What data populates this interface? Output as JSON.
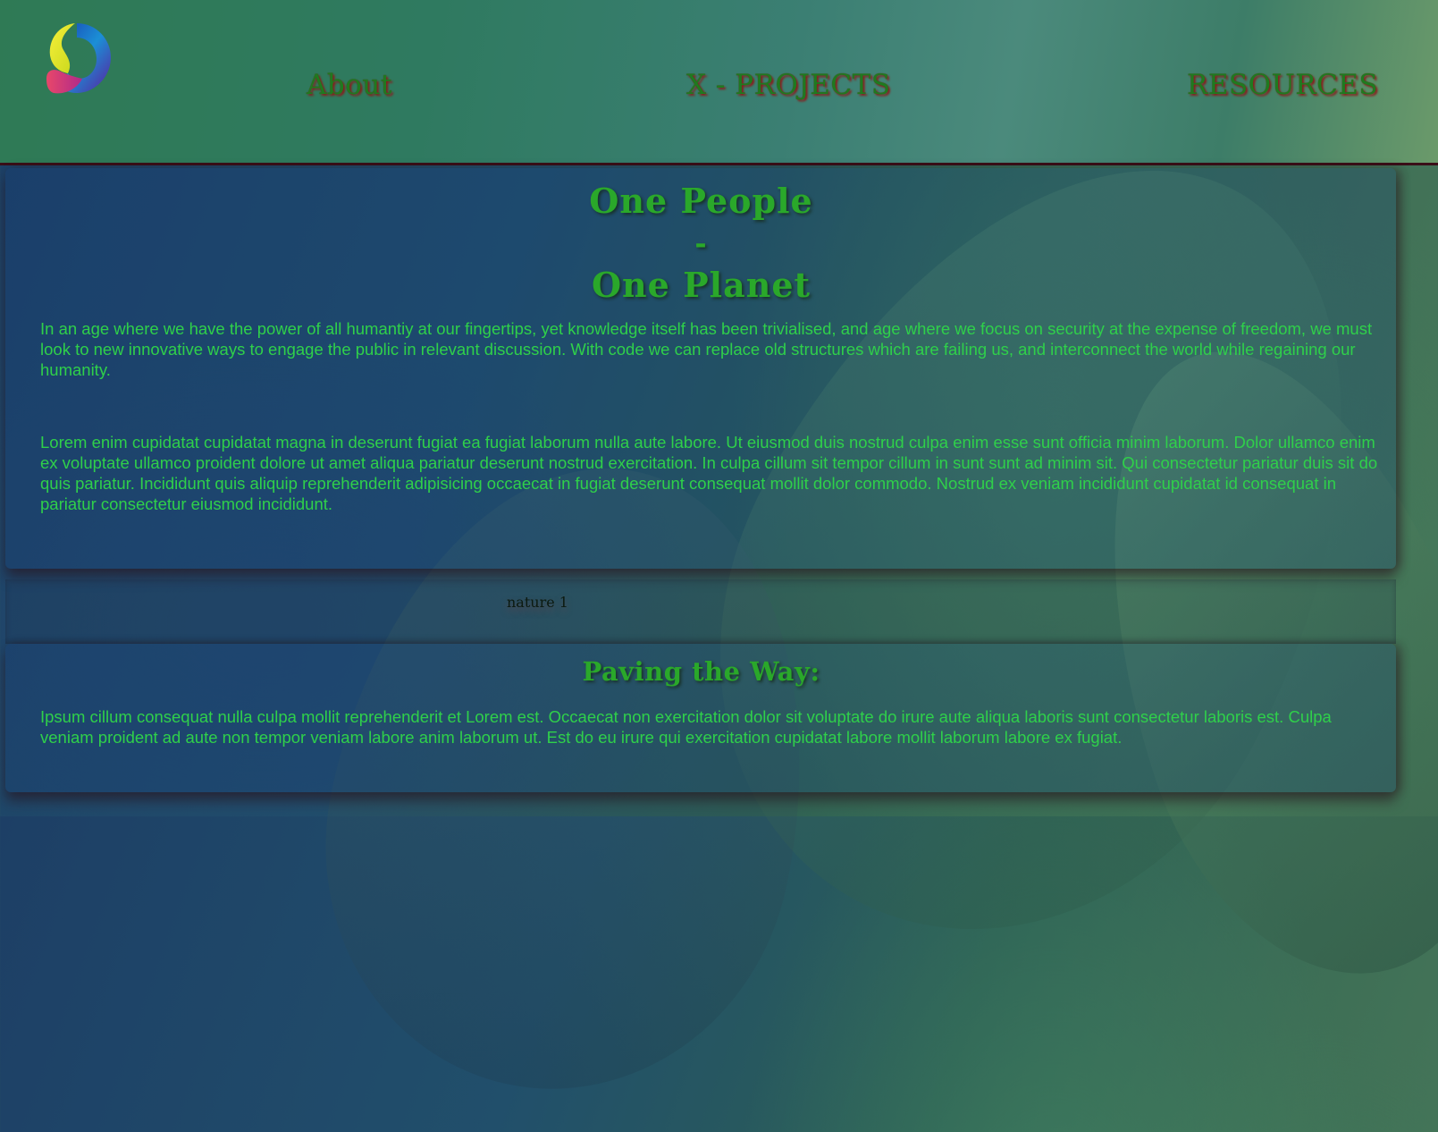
{
  "nav": {
    "items": [
      {
        "label": "About"
      },
      {
        "label": "X - PROJECTS"
      },
      {
        "label": "RESOURCES"
      }
    ]
  },
  "hero": {
    "line1": "One People",
    "line2": "-",
    "line3": "One Planet",
    "intro": "In an age where we have the power of all humantiy at our fingertips, yet knowledge itself has been trivialised, and age where we focus on security at the expense of freedom, we must look to new innovative ways to engage the public in relevant discussion. With code we can replace old structures which are failing us, and interconnect the world while regaining our humanity.",
    "lorem": "Lorem enim cupidatat cupidatat magna in deserunt fugiat ea fugiat laborum nulla aute labore. Ut eiusmod duis nostrud culpa enim esse sunt officia minim laborum. Dolor ullamco enim ex voluptate ullamco proident dolore ut amet aliqua pariatur deserunt nostrud exercitation. In culpa cillum sit tempor cillum in sunt sunt ad minim sit. Qui consectetur pariatur duis sit do quis pariatur. Incididunt quis aliquip reprehenderit adipisicing occaecat in fugiat deserunt consequat mollit dolor commodo. Nostrud ex veniam incididunt cupidatat id consequat in pariatur consectetur eiusmod incididunt."
  },
  "image": {
    "alt": "nature 1"
  },
  "paving": {
    "title": "Paving the Way:",
    "text": "Ipsum cillum consequat nulla culpa mollit reprehenderit et Lorem est. Occaecat non exercitation dolor sit voluptate do irure aute aliqua laboris sunt consectetur laboris est. Culpa veniam proident ad aute non tempor veniam labore anim laborum ut. Est do eu irure qui exercitation cupidatat labore mollit laborum labore ex fugiat."
  },
  "colors": {
    "text_green": "#2fd04a",
    "heading_green": "#2aa82a",
    "nav_green": "#1f7a1f",
    "nav_shadow_red": "#8a1a1a",
    "header_border": "#3a0f18"
  },
  "icons": {
    "logo": "swirl-logo-icon"
  }
}
